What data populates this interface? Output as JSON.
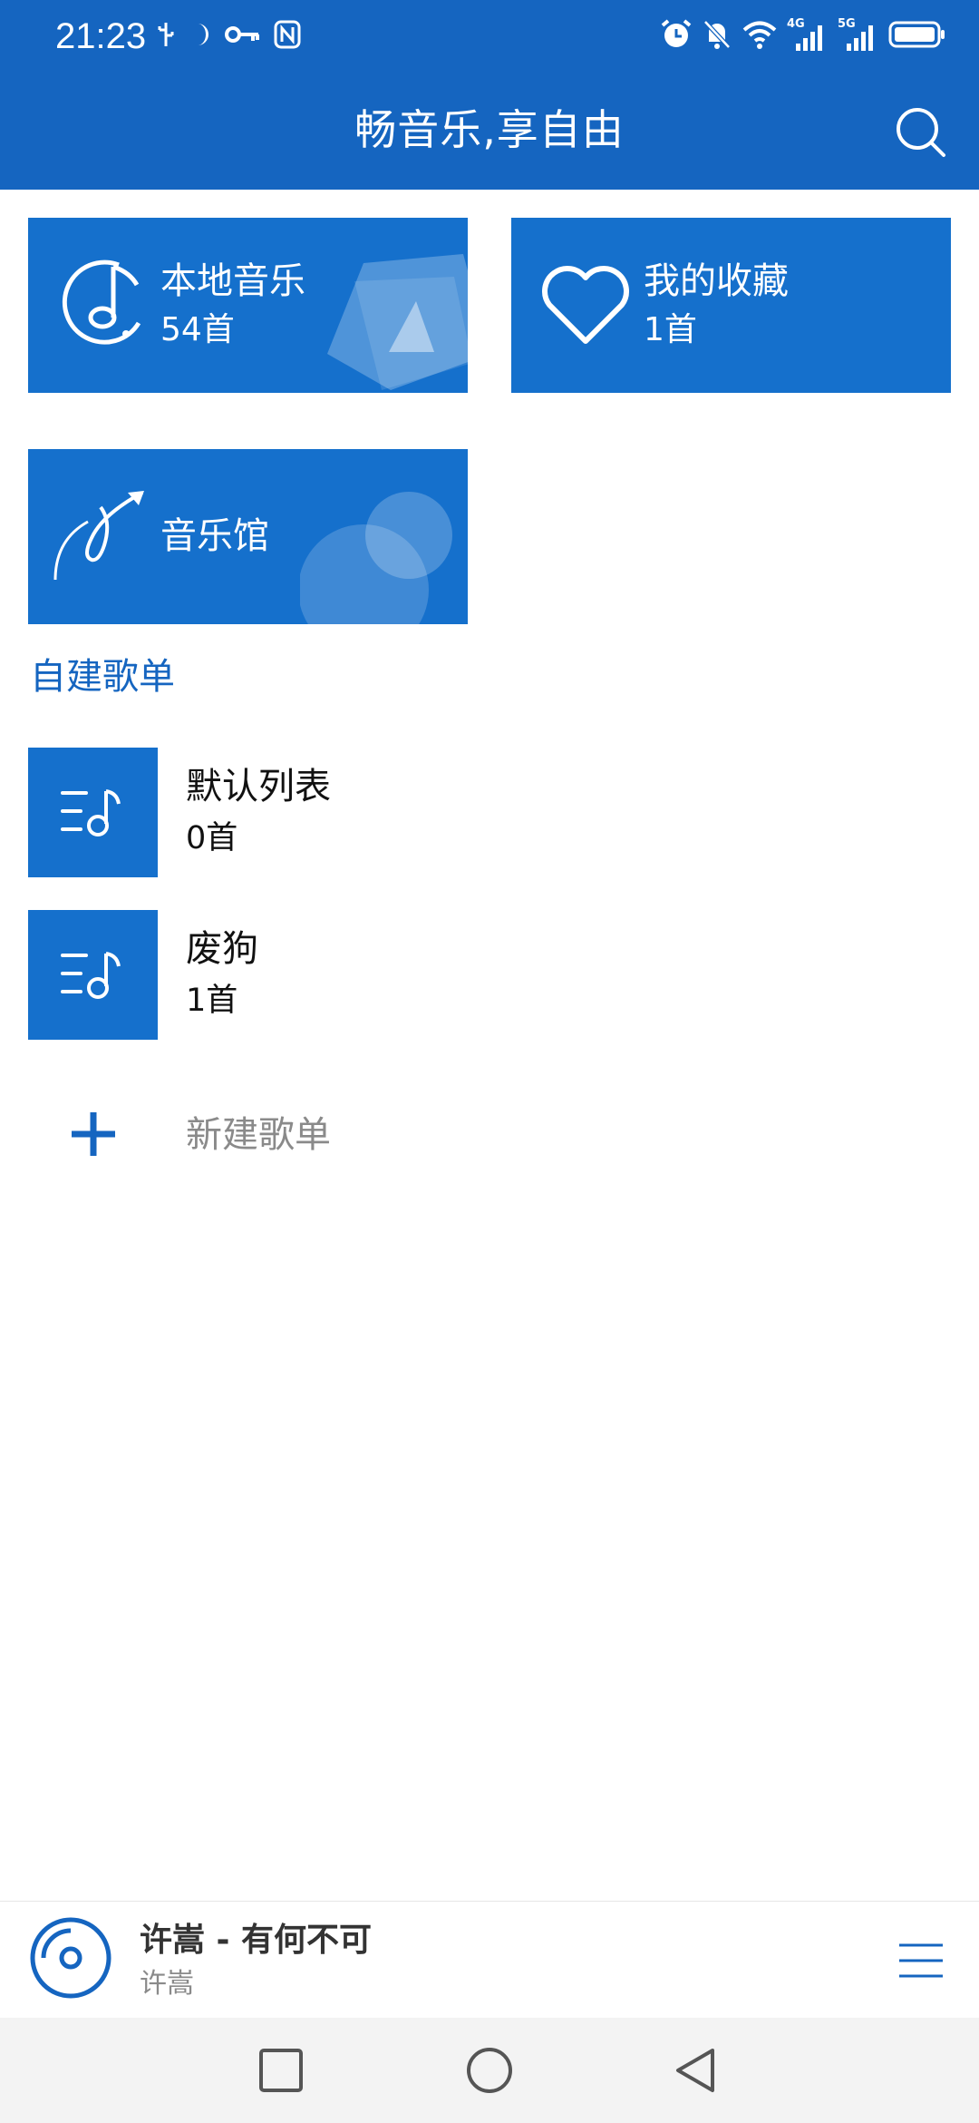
{
  "status_bar": {
    "time": "21:23",
    "left_icons": [
      "usb-icon",
      "moon-icon",
      "key-icon",
      "nfc-icon"
    ],
    "right_icons": [
      "alarm-icon",
      "bell-off-icon",
      "wifi-icon",
      "signal-4g-icon",
      "signal-5g-icon",
      "battery-icon"
    ],
    "net_label_1": "4G",
    "net_label_2": "5G"
  },
  "header": {
    "title": "畅音乐,享自由",
    "search_icon": "search-icon"
  },
  "tiles": {
    "local": {
      "title": "本地音乐",
      "count": "54首",
      "icon": "music-note-icon"
    },
    "favorites": {
      "title": "我的收藏",
      "count": "1首",
      "icon": "heart-icon"
    },
    "hall": {
      "title": "音乐馆",
      "icon": "music-arrow-icon"
    }
  },
  "playlists": {
    "section_title": "自建歌单",
    "items": [
      {
        "name": "默认列表",
        "count": "0首"
      },
      {
        "name": "废狗",
        "count": "1首"
      }
    ],
    "new_label": "新建歌单"
  },
  "player": {
    "song": "许嵩 - 有何不可",
    "artist": "许嵩"
  },
  "colors": {
    "primary": "#1565c0",
    "tile": "#1570cc"
  }
}
